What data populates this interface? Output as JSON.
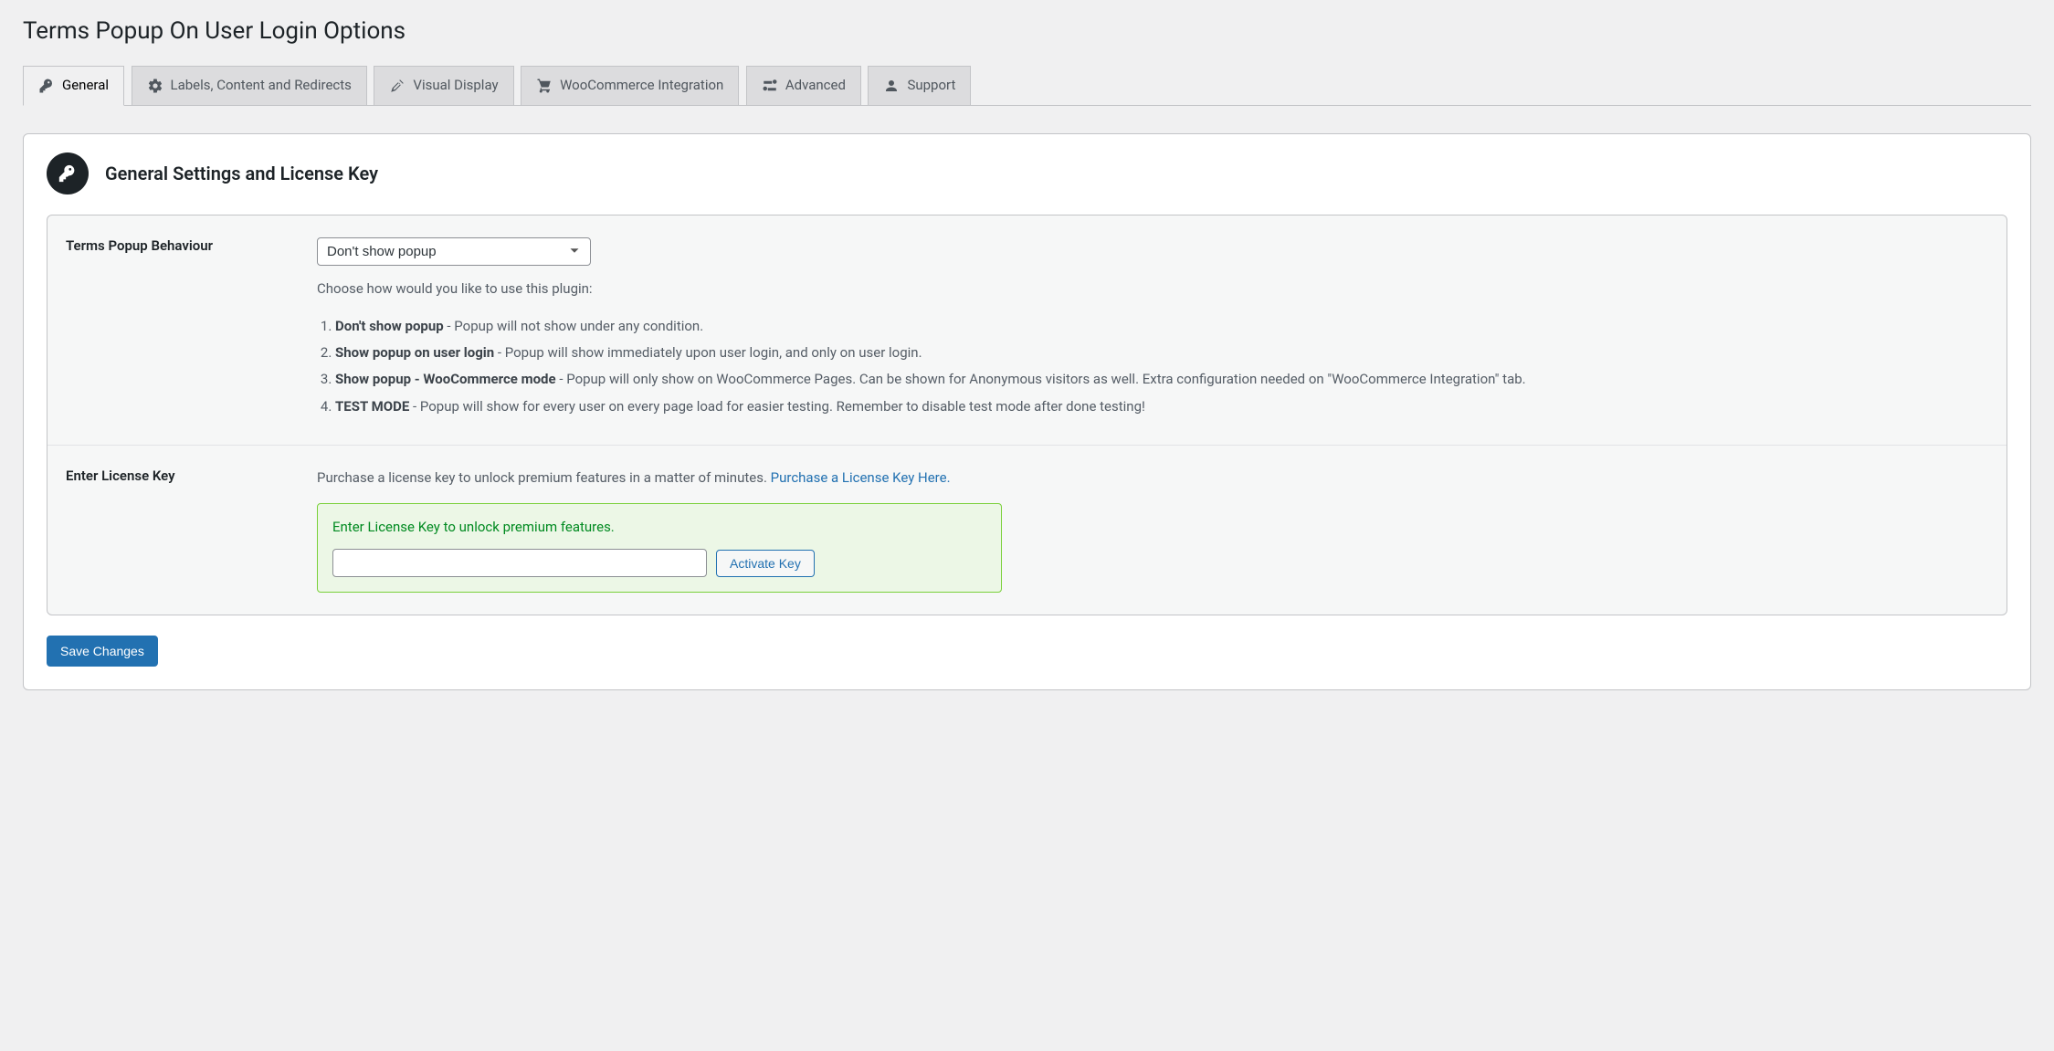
{
  "page": {
    "title": "Terms Popup On User Login Options"
  },
  "tabs": [
    {
      "label": "General",
      "icon": "key-icon"
    },
    {
      "label": "Labels, Content and Redirects",
      "icon": "gear-icon"
    },
    {
      "label": "Visual Display",
      "icon": "pin-icon"
    },
    {
      "label": "WooCommerce Integration",
      "icon": "cart-icon"
    },
    {
      "label": "Advanced",
      "icon": "toggle-icon"
    },
    {
      "label": "Support",
      "icon": "person-icon"
    }
  ],
  "section": {
    "title": "General Settings and License Key"
  },
  "behaviour": {
    "label": "Terms Popup Behaviour",
    "selected": "Don't show popup",
    "desc": "Choose how would you like to use this plugin:",
    "options": [
      {
        "name": "Don't show popup",
        "text": " - Popup will not show under any condition."
      },
      {
        "name": "Show popup on user login",
        "text": " - Popup will show immediately upon user login, and only on user login."
      },
      {
        "name": "Show popup - WooCommerce mode",
        "text": " - Popup will only show on WooCommerce Pages. Can be shown for Anonymous visitors as well. Extra configuration needed on \"WooCommerce Integration\" tab."
      },
      {
        "name": "TEST MODE",
        "text": " - Popup will show for every user on every page load for easier testing. Remember to disable test mode after done testing!"
      }
    ]
  },
  "license": {
    "label": "Enter License Key",
    "intro_prefix": "Purchase a license key to unlock premium features in a matter of minutes. ",
    "link_text": "Purchase a License Key Here.",
    "hint": "Enter License Key to unlock premium features.",
    "input_value": "",
    "activate_label": "Activate Key"
  },
  "actions": {
    "save": "Save Changes"
  }
}
